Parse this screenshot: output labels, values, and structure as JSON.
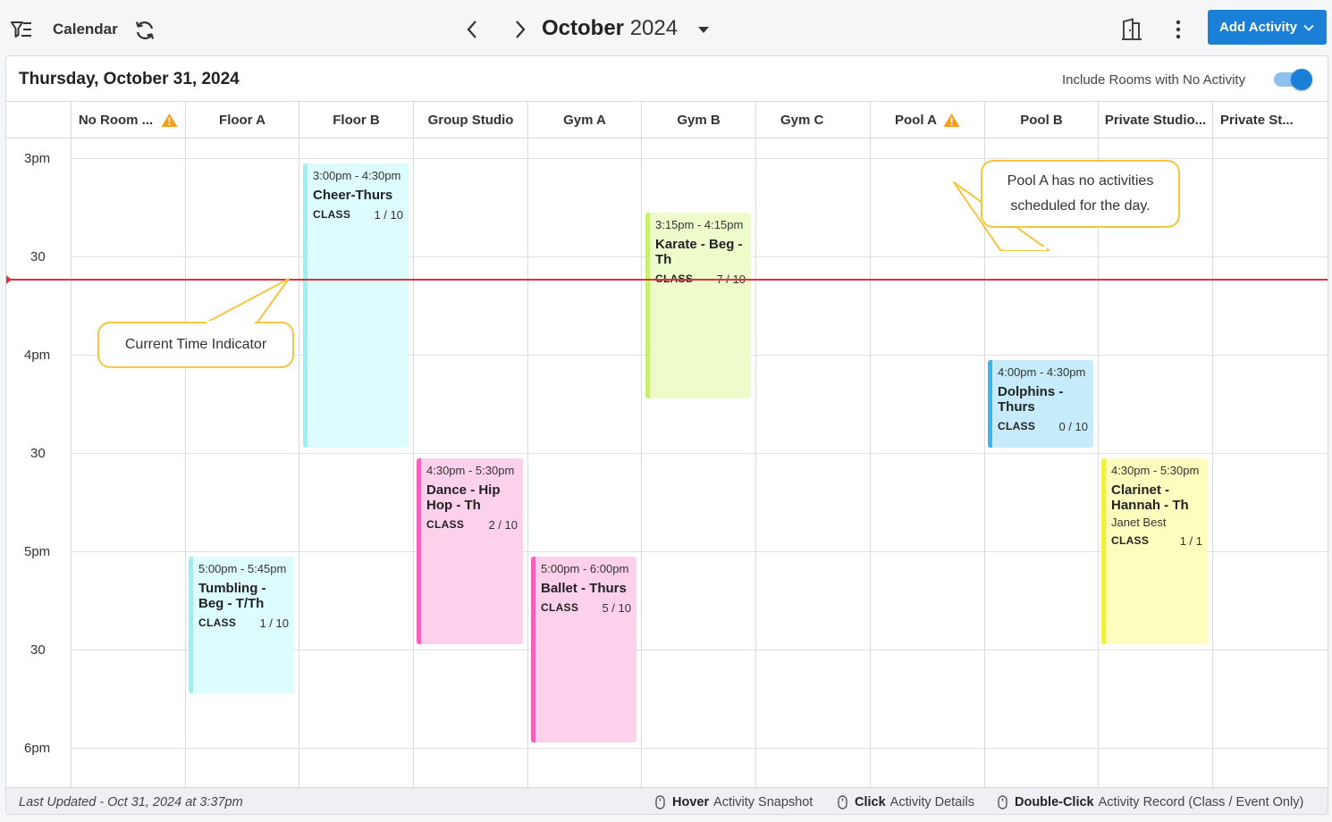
{
  "toolbar": {
    "title": "Calendar",
    "month": "October",
    "year": "2024",
    "add_button": "Add Activity"
  },
  "panel": {
    "date_title": "Thursday, October 31, 2024",
    "toggle_label": "Include Rooms with No Activity",
    "toggle_on": true
  },
  "rooms": [
    "No Room ...",
    "Floor A",
    "Floor B",
    "Group Studio",
    "Gym A",
    "Gym B",
    "Gym C",
    "Pool A",
    "Pool B",
    "Private Studio...",
    "Private St..."
  ],
  "time_labels": [
    "3pm",
    "30",
    "4pm",
    "30",
    "5pm",
    "30",
    "6pm"
  ],
  "events": [
    {
      "time": "3:00pm - 4:30pm",
      "title": "Cheer-Thurs",
      "type": "CLASS",
      "count": "1 / 10"
    },
    {
      "time": "3:15pm - 4:15pm",
      "title": "Karate - Beg - Th",
      "type": "CLASS",
      "count": "7 / 10"
    },
    {
      "time": "4:00pm - 4:30pm",
      "title": "Dolphins - Thurs",
      "type": "CLASS",
      "count": "0 / 10"
    },
    {
      "time": "4:30pm - 5:30pm",
      "title": "Dance - Hip Hop - Th",
      "type": "CLASS",
      "count": "2 / 10"
    },
    {
      "time": "4:30pm - 5:30pm",
      "title": "Clarinet - Hannah - Th",
      "instructor": "Janet Best",
      "type": "CLASS",
      "count": "1 / 1"
    },
    {
      "time": "5:00pm - 5:45pm",
      "title": "Tumbling - Beg - T/Th",
      "type": "CLASS",
      "count": "1 / 10"
    },
    {
      "time": "5:00pm - 6:00pm",
      "title": "Ballet - Thurs",
      "type": "CLASS",
      "count": "5 / 10"
    }
  ],
  "callouts": {
    "current_time": "Current Time Indicator",
    "pool_a_line1": "Pool A has no activities",
    "pool_a_line2": "scheduled for the day."
  },
  "footer": {
    "last_updated": "Last Updated - Oct 31, 2024 at 3:37pm",
    "hint1_action": "Hover",
    "hint1_text": "Activity Snapshot",
    "hint2_action": "Click",
    "hint2_text": "Activity Details",
    "hint3_action": "Double-Click",
    "hint3_text": "Activity Record (Class / Event Only)"
  },
  "colors": {
    "accent": "#1a7fd6",
    "now_line": "#e0303c",
    "warning": "#f59c1a",
    "callout_border": "#f5c542",
    "cyan_event": "#ddfcfd",
    "lime_event": "#eefccc",
    "blue_event": "#c6ecfb",
    "pink_event": "#fdd0ec",
    "yellow_event": "#fdfdbd"
  },
  "icons": [
    "filter-list-icon",
    "refresh-icon",
    "chevron-left-icon",
    "chevron-right-icon",
    "caret-down-icon",
    "rooms-building-icon",
    "kebab-menu-icon",
    "chevron-down-icon",
    "warning-icon",
    "mouse-icon"
  ]
}
